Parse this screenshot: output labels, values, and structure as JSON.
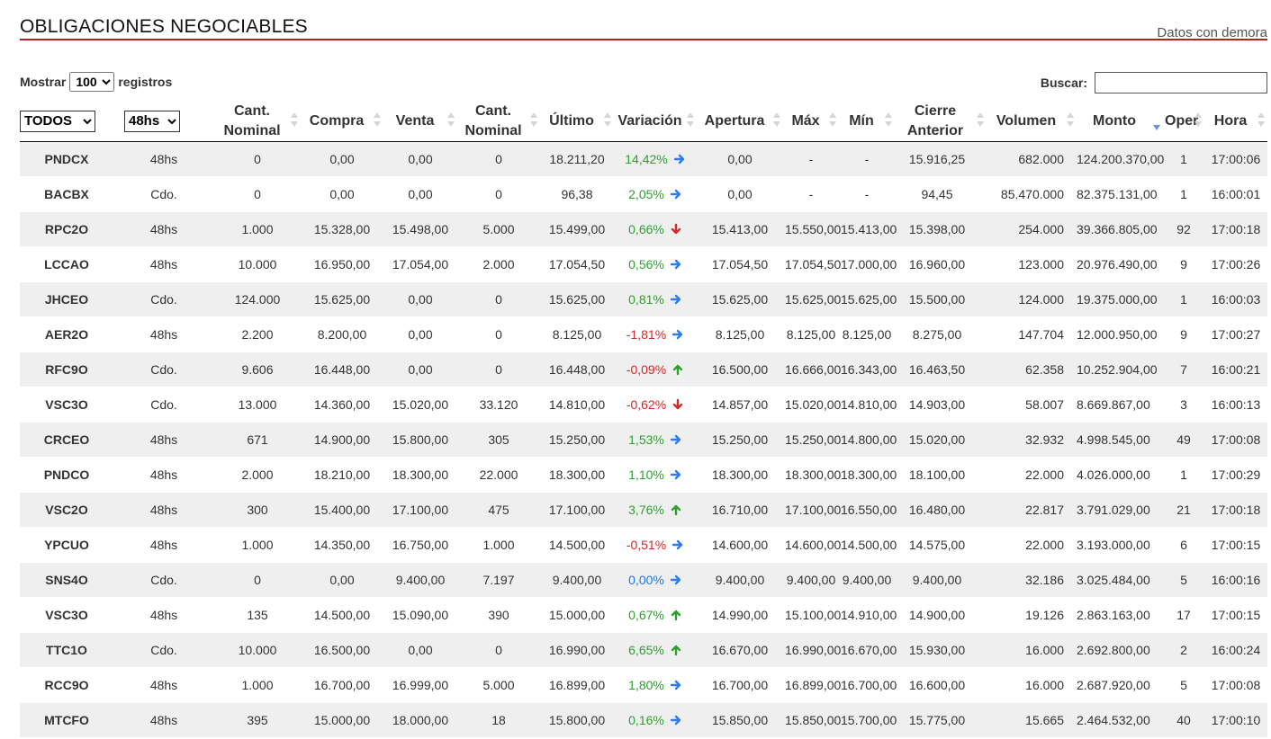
{
  "header": {
    "title": "OBLIGACIONES NEGOCIABLES",
    "delay_note": "Datos con demora"
  },
  "length_control": {
    "prefix": "Mostrar",
    "value": "100",
    "suffix": "registros"
  },
  "search": {
    "label": "Buscar:",
    "value": ""
  },
  "filters": {
    "especie": "TODOS",
    "plazo": "48hs"
  },
  "columns": [
    "Cant. Nominal",
    "Compra",
    "Venta",
    "Cant. Nominal",
    "Último",
    "Variación",
    "Apertura",
    "Máx",
    "Mín",
    "Cierre Anterior",
    "Volumen",
    "Monto",
    "Oper",
    "Hora"
  ],
  "colors": {
    "positive": "#2ca02c",
    "negative": "#d62728",
    "neutral": "#1f77d8",
    "title_rule": "#b22222",
    "row_stripe": "#efefef"
  },
  "rows": [
    {
      "especie": "PNDCX",
      "plazo": "48hs",
      "cant_compra": "0",
      "compra": "0,00",
      "venta": "0,00",
      "cant_venta": "0",
      "ultimo": "18.211,20",
      "variacion": "14,42%",
      "trend": "right",
      "apertura": "0,00",
      "max": "-",
      "min": "-",
      "cierre": "15.916,25",
      "volumen": "682.000",
      "monto": "124.200.370,00",
      "oper": "1",
      "hora": "17:00:06"
    },
    {
      "especie": "BACBX",
      "plazo": "Cdo.",
      "cant_compra": "0",
      "compra": "0,00",
      "venta": "0,00",
      "cant_venta": "0",
      "ultimo": "96,38",
      "variacion": "2,05%",
      "trend": "right",
      "apertura": "0,00",
      "max": "-",
      "min": "-",
      "cierre": "94,45",
      "volumen": "85.470.000",
      "monto": "82.375.131,00",
      "oper": "1",
      "hora": "16:00:01"
    },
    {
      "especie": "RPC2O",
      "plazo": "48hs",
      "cant_compra": "1.000",
      "compra": "15.328,00",
      "venta": "15.498,00",
      "cant_venta": "5.000",
      "ultimo": "15.499,00",
      "variacion": "0,66%",
      "trend": "down",
      "apertura": "15.413,00",
      "max": "15.550,00",
      "min": "15.413,00",
      "cierre": "15.398,00",
      "volumen": "254.000",
      "monto": "39.366.805,00",
      "oper": "92",
      "hora": "17:00:18"
    },
    {
      "especie": "LCCAO",
      "plazo": "48hs",
      "cant_compra": "10.000",
      "compra": "16.950,00",
      "venta": "17.054,00",
      "cant_venta": "2.000",
      "ultimo": "17.054,50",
      "variacion": "0,56%",
      "trend": "right",
      "apertura": "17.054,50",
      "max": "17.054,50",
      "min": "17.000,00",
      "cierre": "16.960,00",
      "volumen": "123.000",
      "monto": "20.976.490,00",
      "oper": "9",
      "hora": "17:00:26"
    },
    {
      "especie": "JHCEO",
      "plazo": "Cdo.",
      "cant_compra": "124.000",
      "compra": "15.625,00",
      "venta": "0,00",
      "cant_venta": "0",
      "ultimo": "15.625,00",
      "variacion": "0,81%",
      "trend": "right",
      "apertura": "15.625,00",
      "max": "15.625,00",
      "min": "15.625,00",
      "cierre": "15.500,00",
      "volumen": "124.000",
      "monto": "19.375.000,00",
      "oper": "1",
      "hora": "16:00:03"
    },
    {
      "especie": "AER2O",
      "plazo": "48hs",
      "cant_compra": "2.200",
      "compra": "8.200,00",
      "venta": "0,00",
      "cant_venta": "0",
      "ultimo": "8.125,00",
      "variacion": "-1,81%",
      "trend": "right",
      "apertura": "8.125,00",
      "max": "8.125,00",
      "min": "8.125,00",
      "cierre": "8.275,00",
      "volumen": "147.704",
      "monto": "12.000.950,00",
      "oper": "9",
      "hora": "17:00:27"
    },
    {
      "especie": "RFC9O",
      "plazo": "Cdo.",
      "cant_compra": "9.606",
      "compra": "16.448,00",
      "venta": "0,00",
      "cant_venta": "0",
      "ultimo": "16.448,00",
      "variacion": "-0,09%",
      "trend": "up",
      "apertura": "16.500,00",
      "max": "16.666,00",
      "min": "16.343,00",
      "cierre": "16.463,50",
      "volumen": "62.358",
      "monto": "10.252.904,00",
      "oper": "7",
      "hora": "16:00:21"
    },
    {
      "especie": "VSC3O",
      "plazo": "Cdo.",
      "cant_compra": "13.000",
      "compra": "14.360,00",
      "venta": "15.020,00",
      "cant_venta": "33.120",
      "ultimo": "14.810,00",
      "variacion": "-0,62%",
      "trend": "down",
      "apertura": "14.857,00",
      "max": "15.020,00",
      "min": "14.810,00",
      "cierre": "14.903,00",
      "volumen": "58.007",
      "monto": "8.669.867,00",
      "oper": "3",
      "hora": "16:00:13"
    },
    {
      "especie": "CRCEO",
      "plazo": "48hs",
      "cant_compra": "671",
      "compra": "14.900,00",
      "venta": "15.800,00",
      "cant_venta": "305",
      "ultimo": "15.250,00",
      "variacion": "1,53%",
      "trend": "right",
      "apertura": "15.250,00",
      "max": "15.250,00",
      "min": "14.800,00",
      "cierre": "15.020,00",
      "volumen": "32.932",
      "monto": "4.998.545,00",
      "oper": "49",
      "hora": "17:00:08"
    },
    {
      "especie": "PNDCO",
      "plazo": "48hs",
      "cant_compra": "2.000",
      "compra": "18.210,00",
      "venta": "18.300,00",
      "cant_venta": "22.000",
      "ultimo": "18.300,00",
      "variacion": "1,10%",
      "trend": "right",
      "apertura": "18.300,00",
      "max": "18.300,00",
      "min": "18.300,00",
      "cierre": "18.100,00",
      "volumen": "22.000",
      "monto": "4.026.000,00",
      "oper": "1",
      "hora": "17:00:29"
    },
    {
      "especie": "VSC2O",
      "plazo": "48hs",
      "cant_compra": "300",
      "compra": "15.400,00",
      "venta": "17.100,00",
      "cant_venta": "475",
      "ultimo": "17.100,00",
      "variacion": "3,76%",
      "trend": "up",
      "apertura": "16.710,00",
      "max": "17.100,00",
      "min": "16.550,00",
      "cierre": "16.480,00",
      "volumen": "22.817",
      "monto": "3.791.029,00",
      "oper": "21",
      "hora": "17:00:18"
    },
    {
      "especie": "YPCUO",
      "plazo": "48hs",
      "cant_compra": "1.000",
      "compra": "14.350,00",
      "venta": "16.750,00",
      "cant_venta": "1.000",
      "ultimo": "14.500,00",
      "variacion": "-0,51%",
      "trend": "right",
      "apertura": "14.600,00",
      "max": "14.600,00",
      "min": "14.500,00",
      "cierre": "14.575,00",
      "volumen": "22.000",
      "monto": "3.193.000,00",
      "oper": "6",
      "hora": "17:00:15"
    },
    {
      "especie": "SNS4O",
      "plazo": "Cdo.",
      "cant_compra": "0",
      "compra": "0,00",
      "venta": "9.400,00",
      "cant_venta": "7.197",
      "ultimo": "9.400,00",
      "variacion": "0,00%",
      "trend": "right",
      "apertura": "9.400,00",
      "max": "9.400,00",
      "min": "9.400,00",
      "cierre": "9.400,00",
      "volumen": "32.186",
      "monto": "3.025.484,00",
      "oper": "5",
      "hora": "16:00:16"
    },
    {
      "especie": "VSC3O",
      "plazo": "48hs",
      "cant_compra": "135",
      "compra": "14.500,00",
      "venta": "15.090,00",
      "cant_venta": "390",
      "ultimo": "15.000,00",
      "variacion": "0,67%",
      "trend": "up",
      "apertura": "14.990,00",
      "max": "15.100,00",
      "min": "14.910,00",
      "cierre": "14.900,00",
      "volumen": "19.126",
      "monto": "2.863.163,00",
      "oper": "17",
      "hora": "17:00:15"
    },
    {
      "especie": "TTC1O",
      "plazo": "Cdo.",
      "cant_compra": "10.000",
      "compra": "16.500,00",
      "venta": "0,00",
      "cant_venta": "0",
      "ultimo": "16.990,00",
      "variacion": "6,65%",
      "trend": "up",
      "apertura": "16.670,00",
      "max": "16.990,00",
      "min": "16.670,00",
      "cierre": "15.930,00",
      "volumen": "16.000",
      "monto": "2.692.800,00",
      "oper": "2",
      "hora": "16:00:24"
    },
    {
      "especie": "RCC9O",
      "plazo": "48hs",
      "cant_compra": "1.000",
      "compra": "16.700,00",
      "venta": "16.999,00",
      "cant_venta": "5.000",
      "ultimo": "16.899,00",
      "variacion": "1,80%",
      "trend": "right",
      "apertura": "16.700,00",
      "max": "16.899,00",
      "min": "16.700,00",
      "cierre": "16.600,00",
      "volumen": "16.000",
      "monto": "2.687.920,00",
      "oper": "5",
      "hora": "17:00:08"
    },
    {
      "especie": "MTCFO",
      "plazo": "48hs",
      "cant_compra": "395",
      "compra": "15.000,00",
      "venta": "18.000,00",
      "cant_venta": "18",
      "ultimo": "15.800,00",
      "variacion": "0,16%",
      "trend": "right",
      "apertura": "15.850,00",
      "max": "15.850,00",
      "min": "15.700,00",
      "cierre": "15.775,00",
      "volumen": "15.665",
      "monto": "2.464.532,00",
      "oper": "40",
      "hora": "17:00:10"
    }
  ]
}
